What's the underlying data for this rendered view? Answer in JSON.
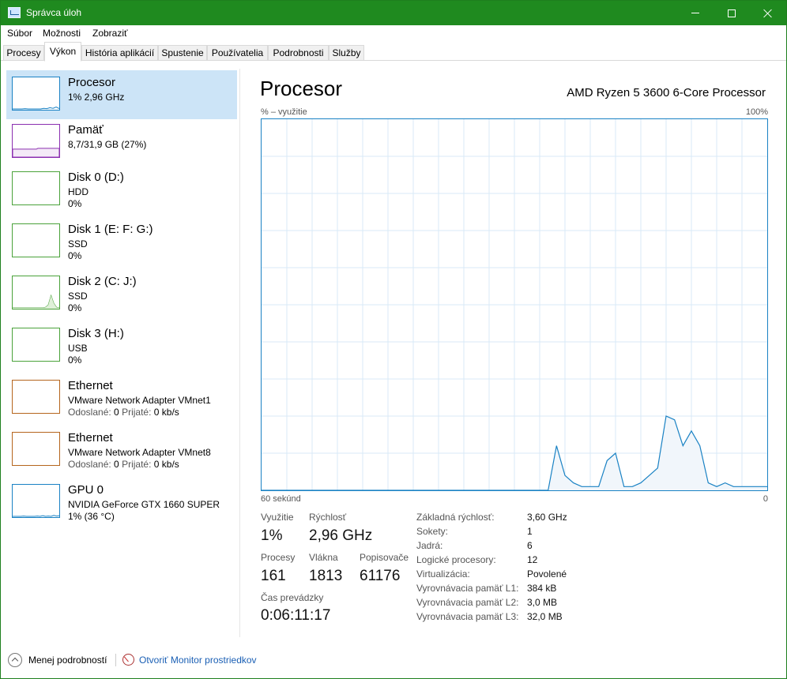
{
  "window": {
    "title": "Správca úloh"
  },
  "menu": {
    "items": [
      "Súbor",
      "Možnosti",
      "Zobraziť"
    ]
  },
  "tabs": [
    "Procesy",
    "Výkon",
    "História aplikácií",
    "Spustenie",
    "Používatelia",
    "Podrobnosti",
    "Služby"
  ],
  "active_tab": "Výkon",
  "resources": [
    {
      "name": "Procesor",
      "line1": "1% 2,96 GHz",
      "color": "#1a82c4",
      "selected": true,
      "history": [
        0,
        0,
        0,
        0,
        1,
        0,
        0,
        0,
        0,
        0,
        2,
        1,
        4,
        2,
        6,
        1
      ]
    },
    {
      "name": "Pamäť",
      "line1": "8,7/31,9 GB (27%)",
      "color": "#8b2fb0",
      "fill_percent": 27
    },
    {
      "name": "Disk 0 (D:)",
      "line1": "HDD",
      "line2": "0%",
      "color": "#4aa23a"
    },
    {
      "name": "Disk 1 (E: F: G:)",
      "line1": "SSD",
      "line2": "0%",
      "color": "#4aa23a"
    },
    {
      "name": "Disk 2 (C: J:)",
      "line1": "SSD",
      "line2": "0%",
      "color": "#4aa23a",
      "history": [
        0,
        0,
        0,
        0,
        0,
        0,
        0,
        0,
        0,
        0,
        0,
        0,
        2,
        9,
        38,
        14,
        2,
        0
      ]
    },
    {
      "name": "Disk 3 (H:)",
      "line1": "USB",
      "line2": "0%",
      "color": "#4aa23a"
    },
    {
      "name": "Ethernet",
      "line1": "VMware Network Adapter VMnet1",
      "sent_label": "Odoslané:",
      "sent": "0",
      "recv_label": "Prijaté:",
      "recv": "0 kb/s",
      "color": "#b5651d"
    },
    {
      "name": "Ethernet",
      "line1": "VMware Network Adapter VMnet8",
      "sent_label": "Odoslané:",
      "sent": "0",
      "recv_label": "Prijaté:",
      "recv": "0 kb/s",
      "color": "#b5651d"
    },
    {
      "name": "GPU 0",
      "line1": "NVIDIA GeForce GTX 1660 SUPER",
      "line2": "1% (36 °C)",
      "color": "#1a82c4",
      "history": [
        0,
        0,
        0,
        0,
        1,
        0,
        0,
        0,
        0,
        1,
        0,
        2,
        0,
        1,
        0,
        3,
        1,
        2
      ]
    }
  ],
  "detail": {
    "title": "Procesor",
    "model": "AMD Ryzen 5 3600 6-Core Processor",
    "y_axis_label": "% – využitie",
    "y_axis_max": "100%",
    "x_axis_left": "60 sekúnd",
    "x_axis_right": "0",
    "stats": {
      "utilization_label": "Využitie",
      "utilization": "1%",
      "speed_label": "Rýchlosť",
      "speed": "2,96 GHz",
      "processes_label": "Procesy",
      "processes": "161",
      "threads_label": "Vlákna",
      "threads": "1813",
      "handles_label": "Popisovače",
      "handles": "61176",
      "uptime_label": "Čas prevádzky",
      "uptime": "0:06:11:17"
    },
    "info": [
      {
        "label": "Základná rýchlosť:",
        "value": "3,60 GHz"
      },
      {
        "label": "Sokety:",
        "value": "1"
      },
      {
        "label": "Jadrá:",
        "value": "6"
      },
      {
        "label": "Logické procesory:",
        "value": "12"
      },
      {
        "label": "Virtualizácia:",
        "value": "Povolené"
      },
      {
        "label": "Vyrovnávacia pamäť L1:",
        "value": "384 kB"
      },
      {
        "label": "Vyrovnávacia pamäť L2:",
        "value": "3,0 MB"
      },
      {
        "label": "Vyrovnávacia pamäť L3:",
        "value": "32,0 MB"
      }
    ]
  },
  "chart_data": {
    "type": "area",
    "ylim": [
      0,
      100
    ],
    "x": [
      60,
      59,
      58,
      57,
      56,
      55,
      54,
      53,
      52,
      51,
      50,
      49,
      48,
      47,
      46,
      45,
      44,
      43,
      42,
      41,
      40,
      39,
      38,
      37,
      36,
      35,
      34,
      33,
      32,
      31,
      30,
      29,
      28,
      27,
      26,
      25,
      24,
      23,
      22,
      21,
      20,
      19,
      18,
      17,
      16,
      15,
      14,
      13,
      12,
      11,
      10,
      9,
      8,
      7,
      6,
      5,
      4,
      3,
      2,
      1,
      0
    ],
    "values": [
      0,
      0,
      0,
      0,
      0,
      0,
      0,
      0,
      0,
      0,
      0,
      0,
      0,
      0,
      0,
      0,
      0,
      0,
      0,
      0,
      0,
      0,
      0,
      0,
      0,
      0,
      0,
      0,
      0,
      0,
      0,
      0,
      0,
      0,
      0,
      12,
      4,
      2,
      1,
      1,
      1,
      8,
      10,
      1,
      1,
      2,
      4,
      6,
      20,
      19,
      12,
      16,
      12,
      2,
      1,
      2,
      1,
      1,
      1,
      1,
      1
    ]
  },
  "footer": {
    "fewer_details": "Menej podrobností",
    "open_monitor": "Otvoriť Monitor prostriedkov"
  }
}
